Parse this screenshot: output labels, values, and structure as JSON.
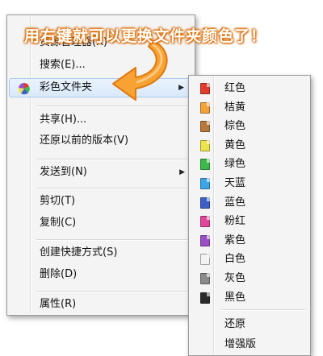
{
  "banner": {
    "text": "用右键就可以更换文件夹颜色了！"
  },
  "context_menu": {
    "items": [
      {
        "label": "资源管理器(X)",
        "submenu": false
      },
      {
        "label": "搜索(E)...",
        "submenu": false
      },
      {
        "label": "彩色文件夹",
        "submenu": true,
        "highlighted": true,
        "icon": "pinwheel-icon"
      },
      {
        "label": "共享(H)...",
        "submenu": false
      },
      {
        "label": "还原以前的版本(V)",
        "submenu": false
      },
      {
        "label": "发送到(N)",
        "submenu": true
      },
      {
        "label": "剪切(T)",
        "submenu": false
      },
      {
        "label": "复制(C)",
        "submenu": false
      },
      {
        "label": "创建快捷方式(S)",
        "submenu": false
      },
      {
        "label": "删除(D)",
        "submenu": false
      },
      {
        "label": "属性(R)",
        "submenu": false
      }
    ]
  },
  "color_submenu": {
    "colors": [
      {
        "label": "红色",
        "color": "#e23b2e"
      },
      {
        "label": "桔黄",
        "color": "#f3a23a"
      },
      {
        "label": "棕色",
        "color": "#b8783c"
      },
      {
        "label": "黄色",
        "color": "#ece44a"
      },
      {
        "label": "绿色",
        "color": "#3cb94a"
      },
      {
        "label": "天蓝",
        "color": "#3ea6e8"
      },
      {
        "label": "蓝色",
        "color": "#3f5fc8"
      },
      {
        "label": "粉红",
        "color": "#e0479a"
      },
      {
        "label": "紫色",
        "color": "#9a4fc7"
      },
      {
        "label": "白色",
        "color": "#f2f2f2"
      },
      {
        "label": "灰色",
        "color": "#8a8a8a"
      },
      {
        "label": "黑色",
        "color": "#2a2a2a"
      }
    ],
    "actions": [
      "还原",
      "增强版"
    ]
  }
}
